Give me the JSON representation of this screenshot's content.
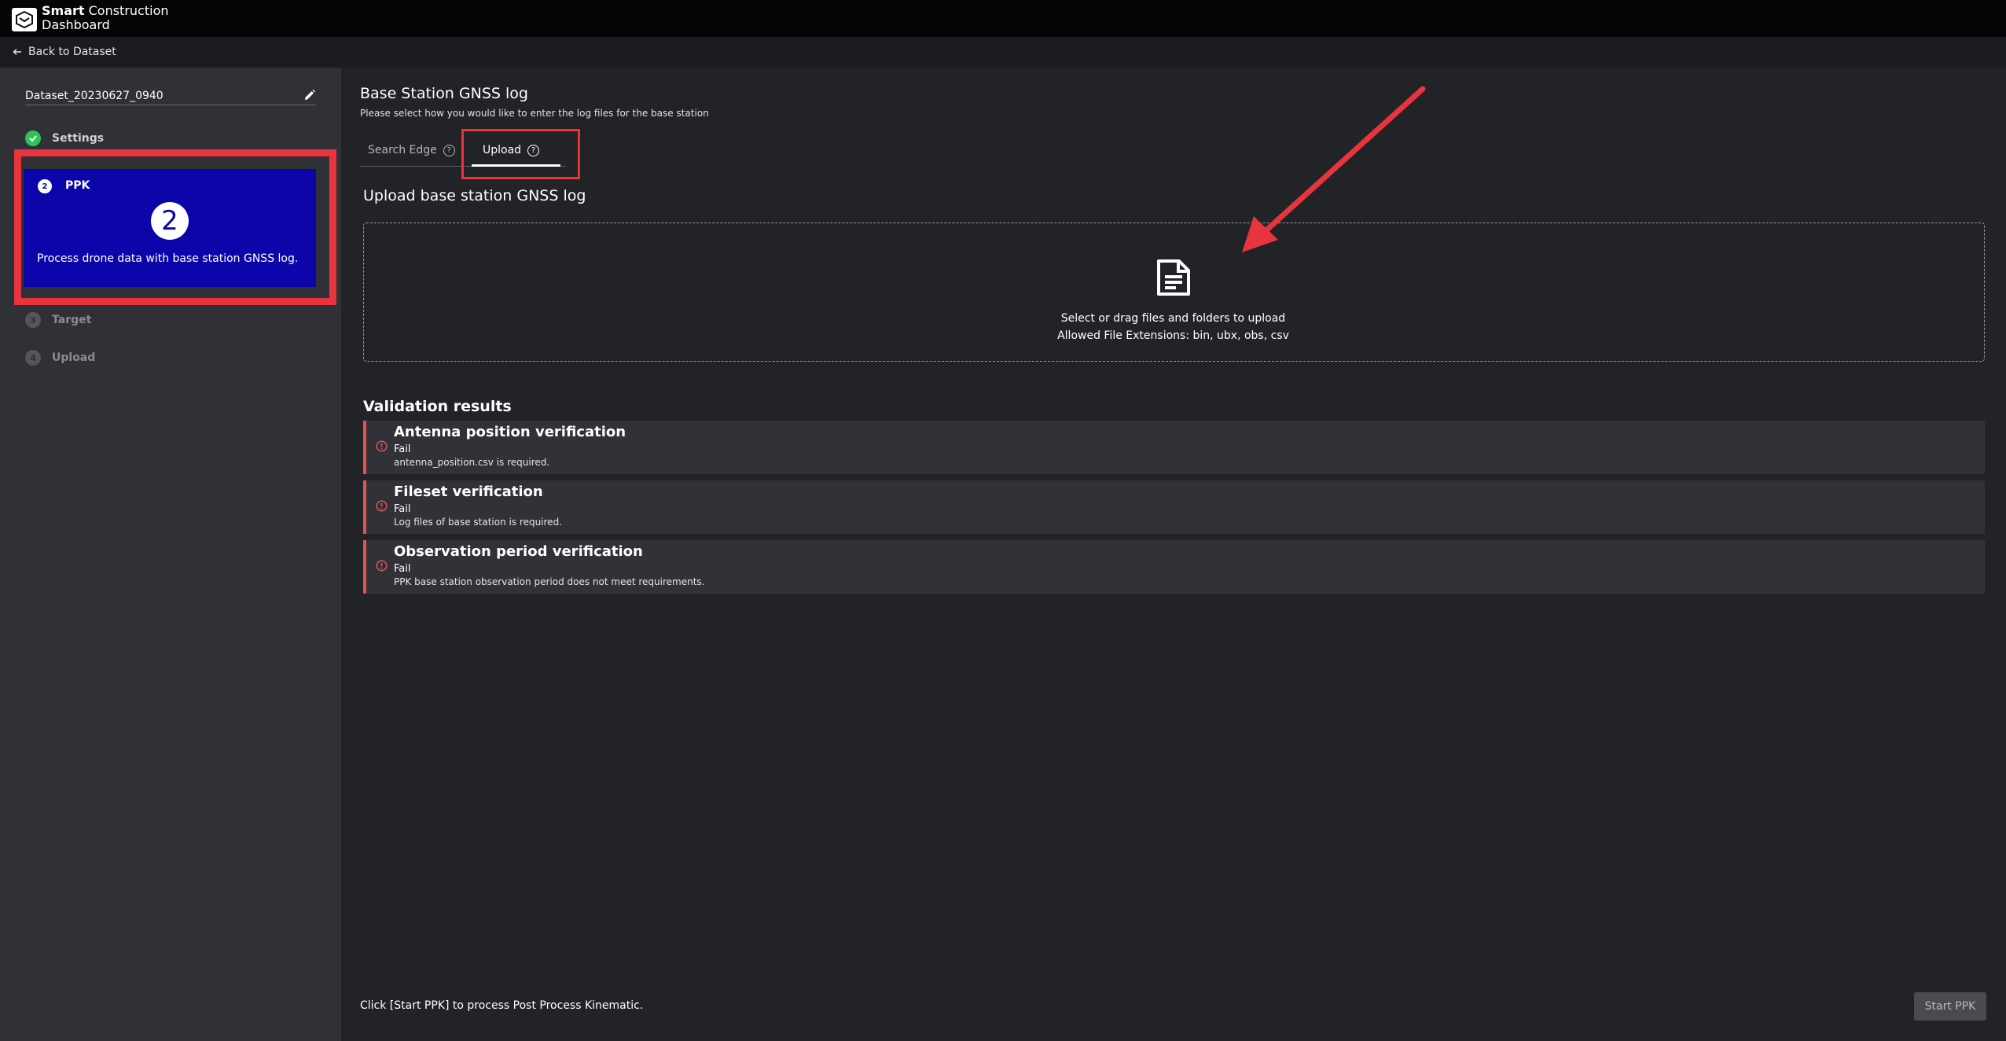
{
  "header": {
    "brand": "Smart",
    "brand_suffix": " Construction",
    "product": "Dashboard"
  },
  "nav": {
    "back_label": "Back to Dataset"
  },
  "sidebar": {
    "dataset_name": "Dataset_20230627_0940",
    "steps": [
      {
        "number": "1",
        "label": "Settings",
        "state": "done"
      },
      {
        "number": "2",
        "label": "PPK",
        "state": "active",
        "description": "Process drone data with base station GNSS log."
      },
      {
        "number": "3",
        "label": "Target",
        "state": "pending"
      },
      {
        "number": "4",
        "label": "Upload",
        "state": "pending"
      }
    ]
  },
  "main": {
    "title": "Base Station GNSS log",
    "subtitle": "Please select how you would like to enter the log files for the base station",
    "tabs": [
      {
        "label": "Search Edge",
        "help": "?"
      },
      {
        "label": "Upload",
        "help": "?"
      }
    ],
    "upload": {
      "heading": "Upload base station GNSS log",
      "instruction": "Select or drag files and folders to upload",
      "extensions": "Allowed File Extensions: bin, ubx, obs, csv"
    },
    "validation": {
      "title": "Validation results",
      "items": [
        {
          "title": "Antenna position verification",
          "status": "Fail",
          "message": "antenna_position.csv is required."
        },
        {
          "title": "Fileset verification",
          "status": "Fail",
          "message": "Log files of base station is required."
        },
        {
          "title": "Observation period verification",
          "status": "Fail",
          "message": "PPK base station observation period does not meet requirements."
        }
      ]
    },
    "footer_text": "Click [Start PPK] to process Post Process Kinematic.",
    "start_button": "Start PPK"
  },
  "colors": {
    "active_step": "#0c06aa",
    "annotation_red": "#e8343c",
    "success": "#2fc35a",
    "error": "#e05258"
  }
}
